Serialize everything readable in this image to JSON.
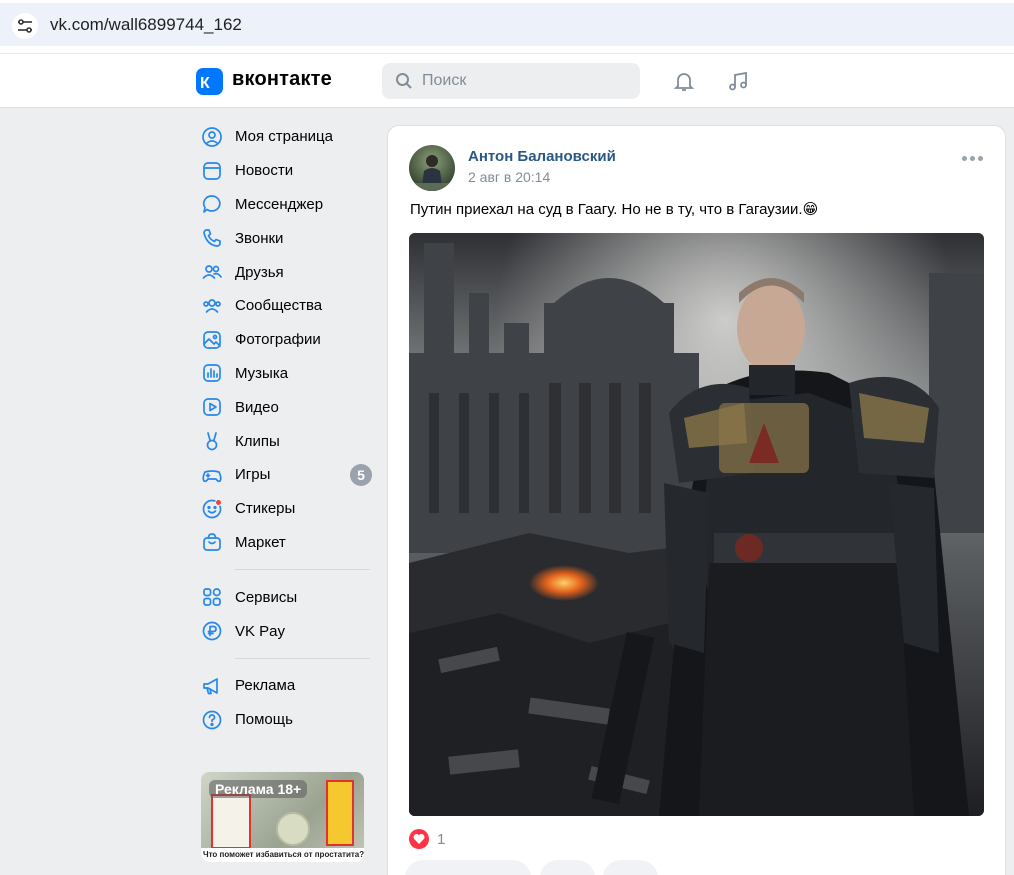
{
  "browser": {
    "url": "vk.com/wall6899744_162"
  },
  "header": {
    "logo_text": "вконтакте",
    "search_placeholder": "Поиск"
  },
  "sidebar": {
    "items": [
      {
        "label": "Моя страница",
        "icon": "user-circle-icon"
      },
      {
        "label": "Новости",
        "icon": "newsfeed-icon"
      },
      {
        "label": "Мессенджер",
        "icon": "message-icon"
      },
      {
        "label": "Звонки",
        "icon": "phone-icon"
      },
      {
        "label": "Друзья",
        "icon": "users-icon"
      },
      {
        "label": "Сообщества",
        "icon": "community-icon"
      },
      {
        "label": "Фотографии",
        "icon": "photo-icon"
      },
      {
        "label": "Музыка",
        "icon": "music-icon"
      },
      {
        "label": "Видео",
        "icon": "video-icon"
      },
      {
        "label": "Клипы",
        "icon": "clips-icon"
      },
      {
        "label": "Игры",
        "icon": "gamepad-icon",
        "badge": "5"
      },
      {
        "label": "Стикеры",
        "icon": "sticker-icon"
      },
      {
        "label": "Маркет",
        "icon": "market-icon"
      }
    ],
    "items2": [
      {
        "label": "Сервисы",
        "icon": "services-icon"
      },
      {
        "label": "VK Pay",
        "icon": "vkpay-icon"
      }
    ],
    "items3": [
      {
        "label": "Реклама",
        "icon": "megaphone-icon"
      },
      {
        "label": "Помощь",
        "icon": "help-icon"
      }
    ],
    "ad": {
      "label": "Реклама 18+",
      "caption": "Что поможет избавиться от простатита?"
    }
  },
  "post": {
    "author": "Антон Балановский",
    "date": "2 авг в 20:14",
    "text": "Путин приехал на суд в Гаагу. Но не в ту, что в Гагаузии.😁",
    "likes_count": "1"
  }
}
